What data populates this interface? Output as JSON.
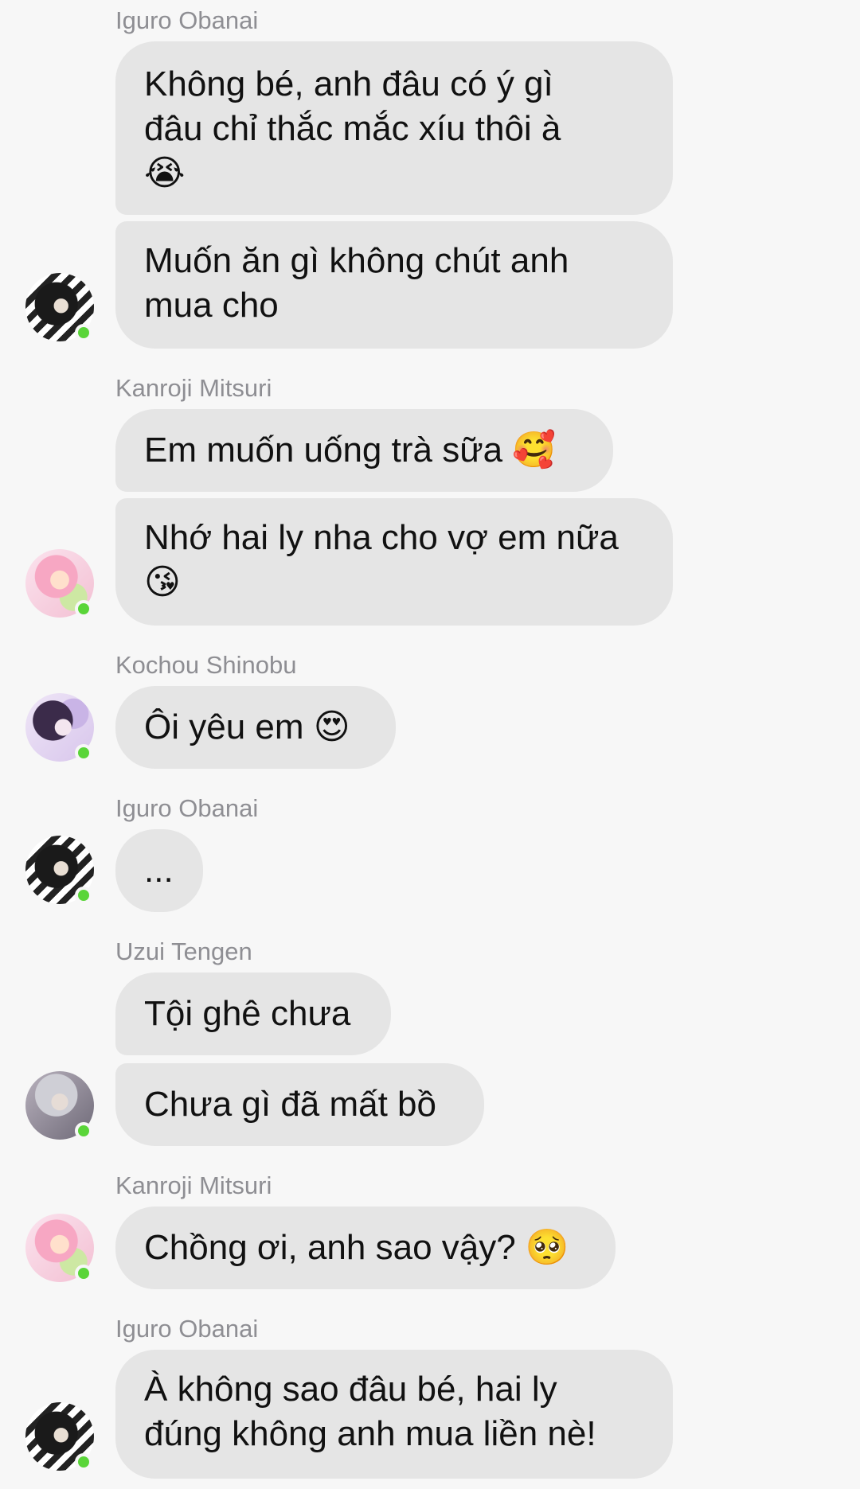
{
  "messages": [
    {
      "sender": "Iguro Obanai",
      "bubbles": [
        "Không bé, anh đâu có ý gì\nđâu chỉ thắc mắc xíu thôi à\n😭",
        "Muốn ăn gì không chút anh\nmua cho"
      ]
    },
    {
      "sender": "Kanroji Mitsuri",
      "bubbles": [
        "Em muốn uống trà sữa 🥰",
        "Nhớ hai ly nha cho vợ em nữa\n😘"
      ]
    },
    {
      "sender": "Kochou Shinobu",
      "bubbles": [
        "Ôi yêu em 😍"
      ]
    },
    {
      "sender": "Iguro Obanai",
      "bubbles": [
        "..."
      ]
    },
    {
      "sender": "Uzui Tengen",
      "bubbles": [
        "Tội ghê chưa",
        "Chưa gì đã mất bồ"
      ]
    },
    {
      "sender": "Kanroji Mitsuri",
      "bubbles": [
        "Chồng ơi, anh sao vậy? 🥺"
      ]
    },
    {
      "sender": "Iguro Obanai",
      "bubbles": [
        "À không sao đâu bé, hai ly\nđúng không anh mua liền nè!"
      ]
    }
  ],
  "status_color": "#5ad539",
  "bubble_color": "#e5e5e5"
}
